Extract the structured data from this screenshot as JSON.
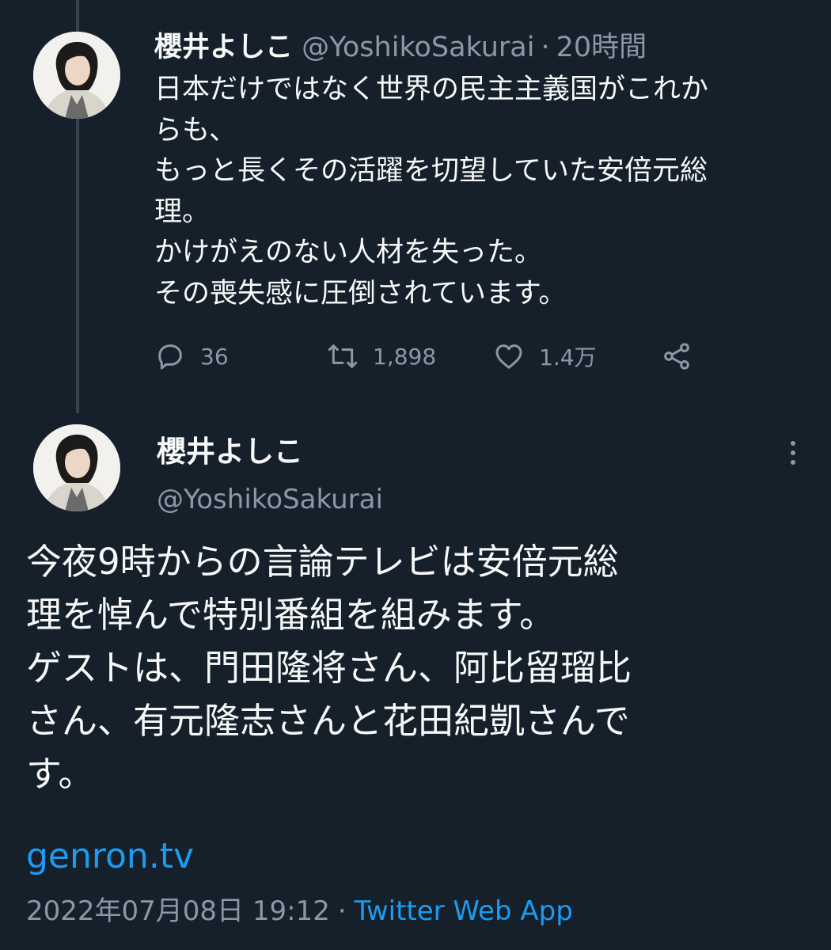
{
  "tweet1": {
    "author_name": "櫻井よしこ",
    "handle": "@YoshikoSakurai",
    "separator": "·",
    "time": "20時間",
    "lines": [
      "日本だけではなく世界の民主主義国がこれか",
      "らも、",
      "もっと長くその活躍を切望していた安倍元総",
      "理。",
      "かけがえのない人材を失った。",
      "その喪失感に圧倒されています。"
    ],
    "actions": {
      "reply_count": "36",
      "retweet_count": "1,898",
      "like_count": "1.4万",
      "icons": [
        "reply-icon",
        "retweet-icon",
        "like-icon",
        "share-icon"
      ]
    }
  },
  "tweet2": {
    "author_name": "櫻井よしこ",
    "handle": "@YoshikoSakurai",
    "lines": [
      "今夜9時からの言論テレビは安倍元総",
      "理を悼んで特別番組を組みます。",
      "ゲストは、門田隆将さん、阿比留瑠比",
      "さん、有元隆志さんと花田紀凱さんで",
      "す。"
    ],
    "link": "genron.tv",
    "timestamp": "2022年07月08日 19:12",
    "separator": "·",
    "source_app": "Twitter Web App"
  },
  "colors": {
    "background": "#15202b",
    "text": "#f7f9f9",
    "muted": "#8b98a5",
    "link": "#1d9bf0",
    "thread_line": "#38444d"
  }
}
